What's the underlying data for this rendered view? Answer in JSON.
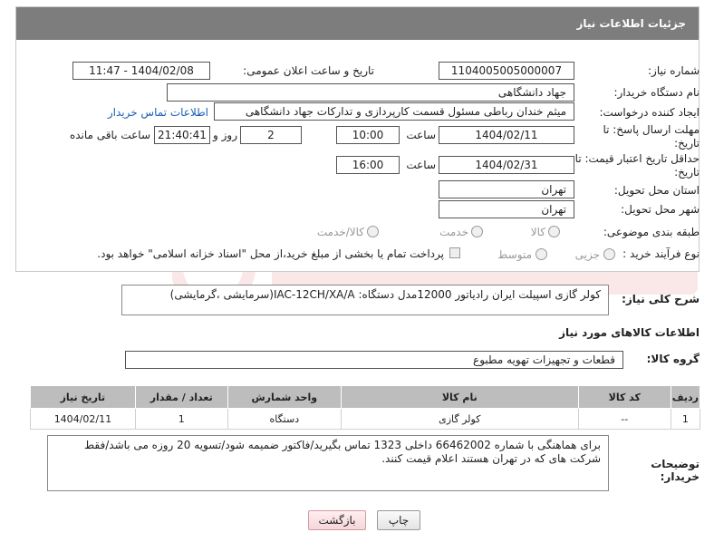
{
  "header": {
    "title": "جزئیات اطلاعات نیاز"
  },
  "fields": {
    "need_number_label": "شماره نیاز:",
    "need_number": "1104005005000007",
    "announce_label": "تاریخ و ساعت اعلان عمومی:",
    "announce_value": "1404/02/08 - 11:47",
    "buyer_org_label": "نام دستگاه خریدار:",
    "buyer_org": "جهاد دانشگاهی",
    "creator_label": "ایجاد کننده درخواست:",
    "creator": "میثم خندان رباطی مسئول قسمت کارپردازی و تدارکات جهاد دانشگاهی",
    "contact_link": "اطلاعات تماس خریدار",
    "deadline_label": "مهلت ارسال پاسخ: تا تاریخ:",
    "deadline_date": "1404/02/11",
    "time_label": "ساعت",
    "deadline_time": "10:00",
    "days_value": "2",
    "days_label": "روز و",
    "remaining_time": "21:40:41",
    "remaining_label": "ساعت باقی مانده",
    "validity_label": "حداقل تاریخ اعتبار قیمت: تا تاریخ:",
    "validity_date": "1404/02/31",
    "validity_time": "16:00",
    "province_label": "استان محل تحویل:",
    "province": "تهران",
    "city_label": "شهر محل تحویل:",
    "city": "تهران",
    "category_label": "طبقه بندی موضوعی:",
    "category_options": [
      "کالا",
      "خدمت",
      "کالا/خدمت"
    ],
    "process_label": "نوع فرآیند خرید :",
    "process_options": [
      "جزیی",
      "متوسط"
    ],
    "payment_note": "پرداخت تمام یا بخشی از مبلغ خرید،از محل \"اسناد خزانه اسلامی\" خواهد بود."
  },
  "summary": {
    "label": "شرح کلی نیاز:",
    "text": "کولر  گازی اسپیلت ایران رادیاتور 12000مدل دستگاه: IAC-12CH/XA/A(سرمایشی ،گرمایشی)"
  },
  "goods_info": {
    "title": "اطلاعات کالاهای مورد نیاز",
    "group_label": "گروه کالا:",
    "group_value": "قطعات و تجهیزات تهویه مطبوع"
  },
  "table": {
    "headers": [
      "ردیف",
      "کد کالا",
      "نام کالا",
      "واحد شمارش",
      "تعداد / مقدار",
      "تاریخ نیاز"
    ],
    "rows": [
      [
        "1",
        "--",
        "کولر گازی",
        "دستگاه",
        "1",
        "1404/02/11"
      ]
    ]
  },
  "notes": {
    "label": "توضیحات خریدار:",
    "text": "برای هماهنگی با شماره 66462002 داخلی 1323 تماس بگیرید/فاکتور ضمیمه شود/تسویه 20 روزه می باشد/فقط شرکت های که در تهران هستند اعلام قیمت کنند."
  },
  "buttons": {
    "print": "چاپ",
    "back": "بازگشت"
  },
  "colors": {
    "header_bg": "#7d7d7d",
    "table_header_bg": "#bdbdbd",
    "link": "#1a5fb4"
  }
}
